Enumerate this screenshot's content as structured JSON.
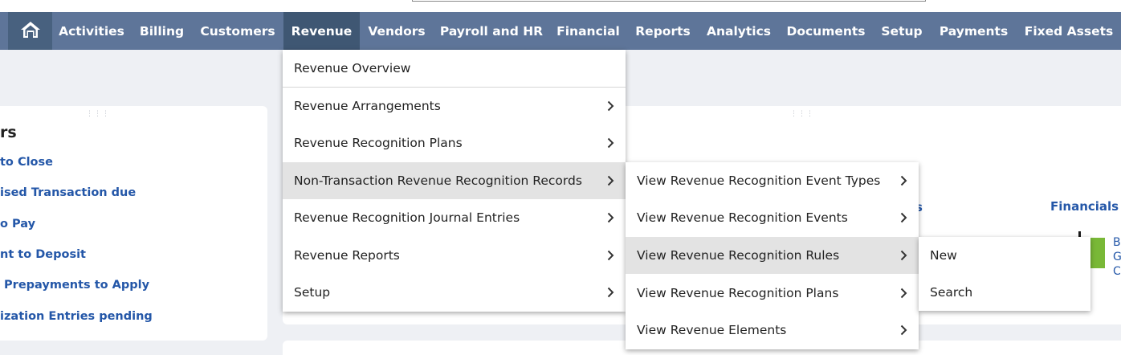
{
  "navbar": {
    "items": [
      {
        "label": "Activities"
      },
      {
        "label": "Billing"
      },
      {
        "label": "Customers"
      },
      {
        "label": "Revenue"
      },
      {
        "label": "Vendors"
      },
      {
        "label": "Payroll and HR"
      },
      {
        "label": "Financial"
      },
      {
        "label": "Reports"
      },
      {
        "label": "Analytics"
      },
      {
        "label": "Documents"
      },
      {
        "label": "Setup"
      },
      {
        "label": "Payments"
      },
      {
        "label": "Fixed Assets"
      }
    ],
    "active": "Revenue"
  },
  "background": {
    "left_portlet_title": "rs",
    "reminders": [
      "to Close",
      "ised Transaction due",
      "o Pay",
      "nt to Deposit",
      " Prepayments to Apply",
      "ization Entries pending"
    ],
    "partial_link": "s",
    "financials_link": "Financials",
    "right_fragments": [
      "B",
      "G",
      "C"
    ]
  },
  "menus": {
    "revenue": [
      {
        "label": "Revenue Overview"
      },
      {
        "label": "Revenue Arrangements"
      },
      {
        "label": "Revenue Recognition Plans"
      },
      {
        "label": "Non-Transaction Revenue Recognition Records"
      },
      {
        "label": "Revenue Recognition Journal Entries"
      },
      {
        "label": "Revenue Reports"
      },
      {
        "label": "Setup"
      }
    ],
    "non_transaction": [
      {
        "label": "View Revenue Recognition Event Types"
      },
      {
        "label": "View Revenue Recognition Events"
      },
      {
        "label": "View Revenue Recognition Rules"
      },
      {
        "label": "View Revenue Recognition Plans"
      },
      {
        "label": "View Revenue Elements"
      }
    ],
    "rules": [
      {
        "label": "New"
      },
      {
        "label": "Search"
      }
    ]
  },
  "colors": {
    "navbar": "#5e7599",
    "navbar_active": "#3f5773",
    "link": "#2457a8",
    "menu_highlight": "#e3e3e3"
  }
}
